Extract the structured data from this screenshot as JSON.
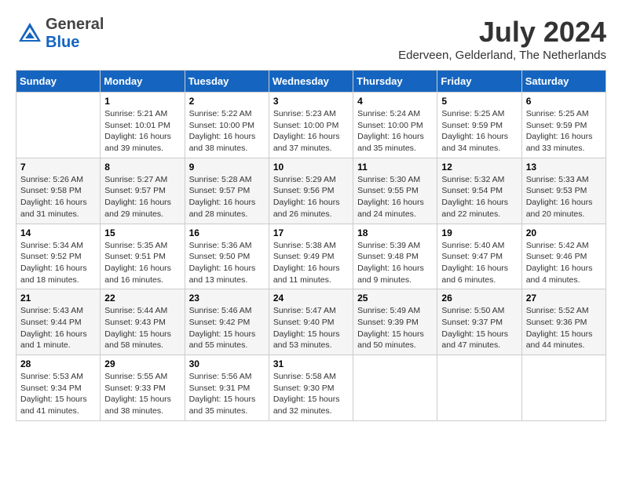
{
  "header": {
    "logo_general": "General",
    "logo_blue": "Blue",
    "month_year": "July 2024",
    "location": "Ederveen, Gelderland, The Netherlands"
  },
  "days_of_week": [
    "Sunday",
    "Monday",
    "Tuesday",
    "Wednesday",
    "Thursday",
    "Friday",
    "Saturday"
  ],
  "weeks": [
    [
      {
        "day": "",
        "info": ""
      },
      {
        "day": "1",
        "info": "Sunrise: 5:21 AM\nSunset: 10:01 PM\nDaylight: 16 hours\nand 39 minutes."
      },
      {
        "day": "2",
        "info": "Sunrise: 5:22 AM\nSunset: 10:00 PM\nDaylight: 16 hours\nand 38 minutes."
      },
      {
        "day": "3",
        "info": "Sunrise: 5:23 AM\nSunset: 10:00 PM\nDaylight: 16 hours\nand 37 minutes."
      },
      {
        "day": "4",
        "info": "Sunrise: 5:24 AM\nSunset: 10:00 PM\nDaylight: 16 hours\nand 35 minutes."
      },
      {
        "day": "5",
        "info": "Sunrise: 5:25 AM\nSunset: 9:59 PM\nDaylight: 16 hours\nand 34 minutes."
      },
      {
        "day": "6",
        "info": "Sunrise: 5:25 AM\nSunset: 9:59 PM\nDaylight: 16 hours\nand 33 minutes."
      }
    ],
    [
      {
        "day": "7",
        "info": "Sunrise: 5:26 AM\nSunset: 9:58 PM\nDaylight: 16 hours\nand 31 minutes."
      },
      {
        "day": "8",
        "info": "Sunrise: 5:27 AM\nSunset: 9:57 PM\nDaylight: 16 hours\nand 29 minutes."
      },
      {
        "day": "9",
        "info": "Sunrise: 5:28 AM\nSunset: 9:57 PM\nDaylight: 16 hours\nand 28 minutes."
      },
      {
        "day": "10",
        "info": "Sunrise: 5:29 AM\nSunset: 9:56 PM\nDaylight: 16 hours\nand 26 minutes."
      },
      {
        "day": "11",
        "info": "Sunrise: 5:30 AM\nSunset: 9:55 PM\nDaylight: 16 hours\nand 24 minutes."
      },
      {
        "day": "12",
        "info": "Sunrise: 5:32 AM\nSunset: 9:54 PM\nDaylight: 16 hours\nand 22 minutes."
      },
      {
        "day": "13",
        "info": "Sunrise: 5:33 AM\nSunset: 9:53 PM\nDaylight: 16 hours\nand 20 minutes."
      }
    ],
    [
      {
        "day": "14",
        "info": "Sunrise: 5:34 AM\nSunset: 9:52 PM\nDaylight: 16 hours\nand 18 minutes."
      },
      {
        "day": "15",
        "info": "Sunrise: 5:35 AM\nSunset: 9:51 PM\nDaylight: 16 hours\nand 16 minutes."
      },
      {
        "day": "16",
        "info": "Sunrise: 5:36 AM\nSunset: 9:50 PM\nDaylight: 16 hours\nand 13 minutes."
      },
      {
        "day": "17",
        "info": "Sunrise: 5:38 AM\nSunset: 9:49 PM\nDaylight: 16 hours\nand 11 minutes."
      },
      {
        "day": "18",
        "info": "Sunrise: 5:39 AM\nSunset: 9:48 PM\nDaylight: 16 hours\nand 9 minutes."
      },
      {
        "day": "19",
        "info": "Sunrise: 5:40 AM\nSunset: 9:47 PM\nDaylight: 16 hours\nand 6 minutes."
      },
      {
        "day": "20",
        "info": "Sunrise: 5:42 AM\nSunset: 9:46 PM\nDaylight: 16 hours\nand 4 minutes."
      }
    ],
    [
      {
        "day": "21",
        "info": "Sunrise: 5:43 AM\nSunset: 9:44 PM\nDaylight: 16 hours\nand 1 minute."
      },
      {
        "day": "22",
        "info": "Sunrise: 5:44 AM\nSunset: 9:43 PM\nDaylight: 15 hours\nand 58 minutes."
      },
      {
        "day": "23",
        "info": "Sunrise: 5:46 AM\nSunset: 9:42 PM\nDaylight: 15 hours\nand 55 minutes."
      },
      {
        "day": "24",
        "info": "Sunrise: 5:47 AM\nSunset: 9:40 PM\nDaylight: 15 hours\nand 53 minutes."
      },
      {
        "day": "25",
        "info": "Sunrise: 5:49 AM\nSunset: 9:39 PM\nDaylight: 15 hours\nand 50 minutes."
      },
      {
        "day": "26",
        "info": "Sunrise: 5:50 AM\nSunset: 9:37 PM\nDaylight: 15 hours\nand 47 minutes."
      },
      {
        "day": "27",
        "info": "Sunrise: 5:52 AM\nSunset: 9:36 PM\nDaylight: 15 hours\nand 44 minutes."
      }
    ],
    [
      {
        "day": "28",
        "info": "Sunrise: 5:53 AM\nSunset: 9:34 PM\nDaylight: 15 hours\nand 41 minutes."
      },
      {
        "day": "29",
        "info": "Sunrise: 5:55 AM\nSunset: 9:33 PM\nDaylight: 15 hours\nand 38 minutes."
      },
      {
        "day": "30",
        "info": "Sunrise: 5:56 AM\nSunset: 9:31 PM\nDaylight: 15 hours\nand 35 minutes."
      },
      {
        "day": "31",
        "info": "Sunrise: 5:58 AM\nSunset: 9:30 PM\nDaylight: 15 hours\nand 32 minutes."
      },
      {
        "day": "",
        "info": ""
      },
      {
        "day": "",
        "info": ""
      },
      {
        "day": "",
        "info": ""
      }
    ]
  ]
}
